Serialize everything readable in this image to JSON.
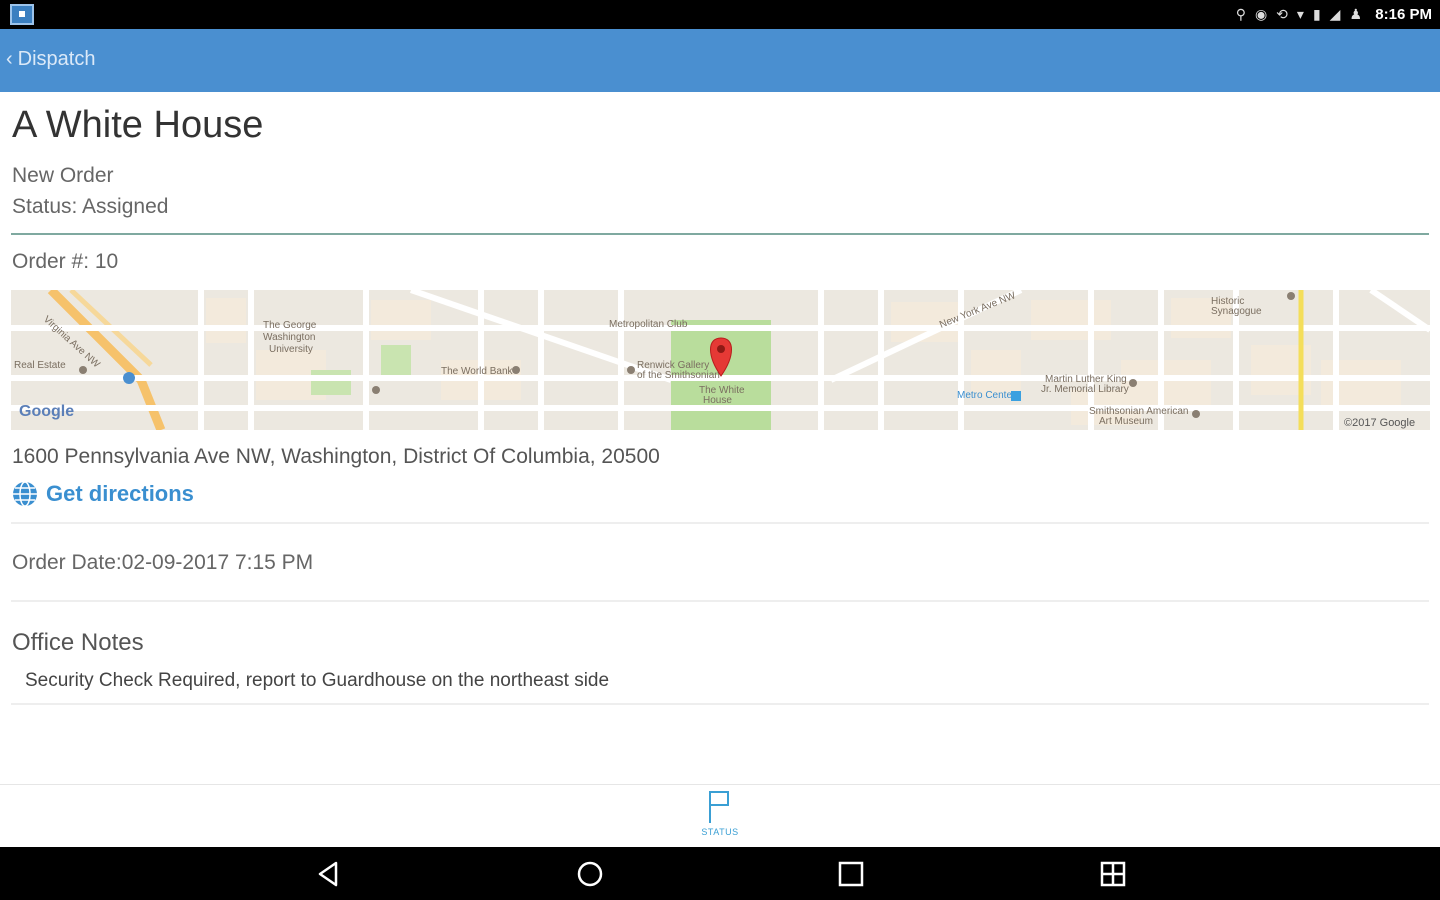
{
  "status_bar": {
    "time": "8:16 PM",
    "icons": [
      "app-icon",
      "location-icon",
      "alarm-icon",
      "sync-icon",
      "wifi-icon",
      "battery-saver-icon",
      "signal-icon",
      "account-icon"
    ]
  },
  "app_bar": {
    "back_label": "Dispatch"
  },
  "order": {
    "title": "A White House",
    "type": "New Order",
    "status": "Status: Assigned",
    "number": "Order #: 10",
    "address": "1600 Pennsylvania Ave NW, Washington, District Of Columbia, 20500",
    "directions_label": "Get directions",
    "order_date": "Order Date:02-09-2017 7:15 PM"
  },
  "map": {
    "logo": "Google",
    "copyright": "©2017 Google",
    "labels": {
      "gwu": "The George Washington University",
      "world_bank": "The World Bank",
      "metropolitan": "Metropolitan Club",
      "renwick": "Renwick Gallery of the Smithsonian",
      "white_house": "The White House",
      "mlk_library": "Martin Luther King Jr. Memorial Library",
      "synagogue": "Historic Synagogue",
      "smithsonian_art": "Smithsonian American Art Museum",
      "metro_center": "Metro Center",
      "real_estate": "Real Estate",
      "ny_ave": "New York Ave NW",
      "virginia_ave": "Virginia Ave NW"
    }
  },
  "office_notes": {
    "title": "Office Notes",
    "body": "Security Check Required,  report to Guardhouse on the northeast side"
  },
  "bottom_tab": {
    "label": "STATUS"
  },
  "colors": {
    "app_bar": "#4a8fd0",
    "link": "#3a8fd0",
    "tab_active": "#3a9fd4",
    "divider_accent": "#7fa9a0"
  }
}
